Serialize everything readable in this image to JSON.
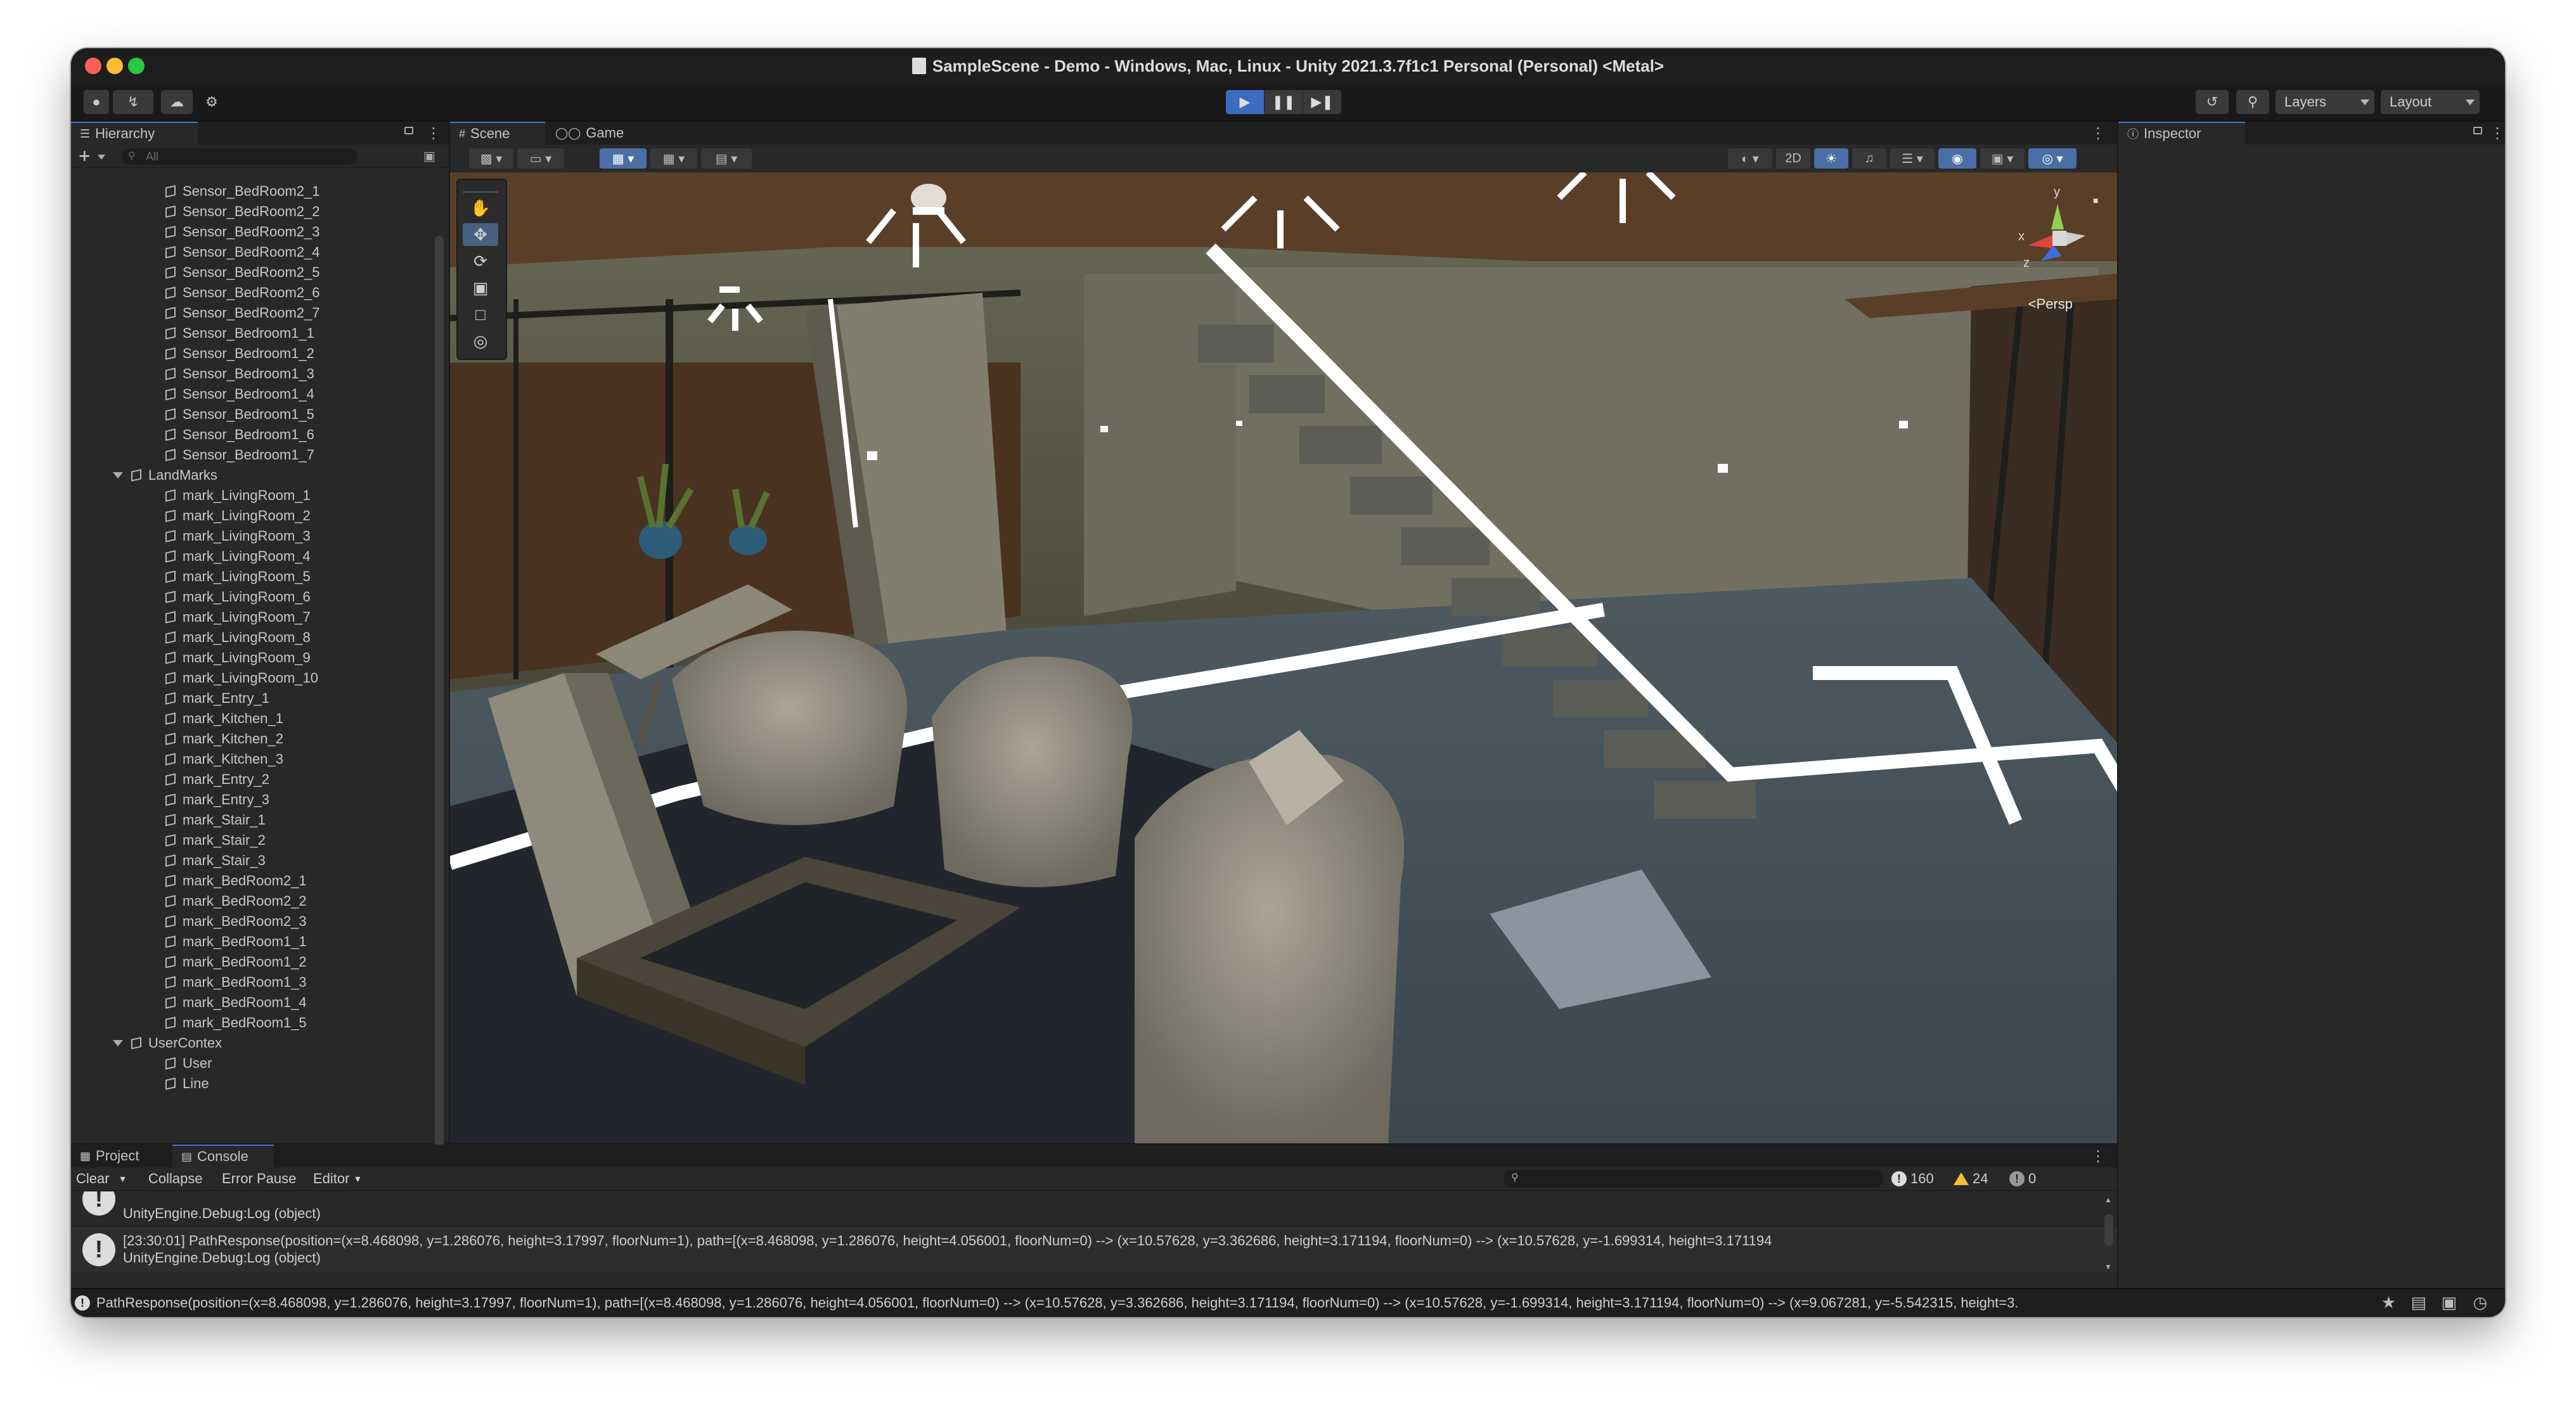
{
  "window": {
    "title": "SampleScene - Demo - Windows, Mac, Linux - Unity 2021.3.7f1c1 Personal (Personal) <Metal>"
  },
  "toolbar": {
    "layers_label": "Layers",
    "layout_label": "Layout",
    "play_state": "playing"
  },
  "hierarchy": {
    "tab_label": "Hierarchy",
    "search_placeholder": "All",
    "items": [
      {
        "label": "Sensor_BedRoom2_1",
        "depth": 2
      },
      {
        "label": "Sensor_BedRoom2_2",
        "depth": 2
      },
      {
        "label": "Sensor_BedRoom2_3",
        "depth": 2
      },
      {
        "label": "Sensor_BedRoom2_4",
        "depth": 2
      },
      {
        "label": "Sensor_BedRoom2_5",
        "depth": 2
      },
      {
        "label": "Sensor_BedRoom2_6",
        "depth": 2
      },
      {
        "label": "Sensor_BedRoom2_7",
        "depth": 2
      },
      {
        "label": "Sensor_Bedroom1_1",
        "depth": 2
      },
      {
        "label": "Sensor_Bedroom1_2",
        "depth": 2
      },
      {
        "label": "Sensor_Bedroom1_3",
        "depth": 2
      },
      {
        "label": "Sensor_Bedroom1_4",
        "depth": 2
      },
      {
        "label": "Sensor_Bedroom1_5",
        "depth": 2
      },
      {
        "label": "Sensor_Bedroom1_6",
        "depth": 2
      },
      {
        "label": "Sensor_Bedroom1_7",
        "depth": 2
      },
      {
        "label": "LandMarks",
        "depth": 1,
        "expanded": true
      },
      {
        "label": "mark_LivingRoom_1",
        "depth": 2
      },
      {
        "label": "mark_LivingRoom_2",
        "depth": 2
      },
      {
        "label": "mark_LivingRoom_3",
        "depth": 2
      },
      {
        "label": "mark_LivingRoom_4",
        "depth": 2
      },
      {
        "label": "mark_LivingRoom_5",
        "depth": 2
      },
      {
        "label": "mark_LivingRoom_6",
        "depth": 2
      },
      {
        "label": "mark_LivingRoom_7",
        "depth": 2
      },
      {
        "label": "mark_LivingRoom_8",
        "depth": 2
      },
      {
        "label": "mark_LivingRoom_9",
        "depth": 2
      },
      {
        "label": "mark_LivingRoom_10",
        "depth": 2
      },
      {
        "label": "mark_Entry_1",
        "depth": 2
      },
      {
        "label": "mark_Kitchen_1",
        "depth": 2
      },
      {
        "label": "mark_Kitchen_2",
        "depth": 2
      },
      {
        "label": "mark_Kitchen_3",
        "depth": 2
      },
      {
        "label": "mark_Entry_2",
        "depth": 2
      },
      {
        "label": "mark_Entry_3",
        "depth": 2
      },
      {
        "label": "mark_Stair_1",
        "depth": 2
      },
      {
        "label": "mark_Stair_2",
        "depth": 2
      },
      {
        "label": "mark_Stair_3",
        "depth": 2
      },
      {
        "label": "mark_BedRoom2_1",
        "depth": 2
      },
      {
        "label": "mark_BedRoom2_2",
        "depth": 2
      },
      {
        "label": "mark_BedRoom2_3",
        "depth": 2
      },
      {
        "label": "mark_BedRoom1_1",
        "depth": 2
      },
      {
        "label": "mark_BedRoom1_2",
        "depth": 2
      },
      {
        "label": "mark_BedRoom1_3",
        "depth": 2
      },
      {
        "label": "mark_BedRoom1_4",
        "depth": 2
      },
      {
        "label": "mark_BedRoom1_5",
        "depth": 2
      },
      {
        "label": "UserContex",
        "depth": 1,
        "expanded": true
      },
      {
        "label": "User",
        "depth": 2
      },
      {
        "label": "Line",
        "depth": 2
      }
    ]
  },
  "scene": {
    "tabs": [
      {
        "label": "Scene",
        "icon": "grid-icon",
        "active": true
      },
      {
        "label": "Game",
        "icon": "gamepad-icon",
        "active": false
      }
    ],
    "toggle_2d": "2D",
    "persp_label": "<Persp",
    "gizmo_axes": {
      "y": "y",
      "x": "x",
      "z": "z"
    }
  },
  "inspector": {
    "tab_label": "Inspector"
  },
  "bottom": {
    "tabs": [
      {
        "label": "Project",
        "icon": "folder-icon",
        "active": false
      },
      {
        "label": "Console",
        "icon": "console-icon",
        "active": true
      }
    ],
    "clear_label": "Clear",
    "collapse_label": "Collapse",
    "error_pause_label": "Error Pause",
    "editor_label": "Editor",
    "counts": {
      "info": "160",
      "warnings": "24",
      "errors": "0"
    },
    "messages": [
      {
        "line1": "",
        "line2": "UnityEngine.Debug:Log (object)"
      },
      {
        "line1": "[23:30:01] PathResponse(position=(x=8.468098, y=1.286076, height=3.17997, floorNum=1), path=[(x=8.468098, y=1.286076, height=4.056001, floorNum=0) --> (x=10.57628, y=3.362686, height=3.171194, floorNum=0) --> (x=10.57628, y=-1.699314, height=3.171194",
        "line2": "UnityEngine.Debug:Log (object)"
      }
    ]
  },
  "statusbar": {
    "text": "PathResponse(position=(x=8.468098, y=1.286076, height=3.17997, floorNum=1), path=[(x=8.468098, y=1.286076, height=4.056001, floorNum=0) --> (x=10.57628, y=3.362686, height=3.171194, floorNum=0) --> (x=10.57628, y=-1.699314, height=3.171194, floorNum=0) --> (x=9.067281, y=-5.542315, height=3."
  },
  "colors": {
    "accent": "#3d6bc0",
    "warning": "#f2c12e",
    "path_line": "#ffffff"
  }
}
